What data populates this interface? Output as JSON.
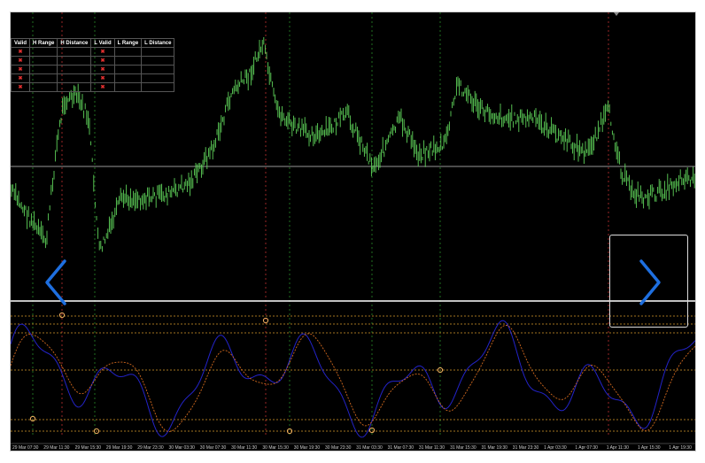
{
  "table": {
    "headers": [
      "Valid",
      "H Range",
      "H Distance",
      "L Valid",
      "L Range",
      "L Distance"
    ],
    "rows": [
      [
        "✖",
        "",
        "",
        "✖",
        "",
        ""
      ],
      [
        "✖",
        "",
        "",
        "✖",
        "",
        ""
      ],
      [
        "✖",
        "",
        "",
        "✖",
        "",
        ""
      ],
      [
        "✖",
        "",
        "",
        "✖",
        "",
        ""
      ],
      [
        "✖",
        "",
        "",
        "✖",
        "",
        ""
      ]
    ]
  },
  "time_axis": [
    "29 Mar 07:30",
    "29 Mar 11:30",
    "29 Mar 15:30",
    "29 Mar 19:30",
    "29 Mar 23:30",
    "30 Mar 03:30",
    "30 Mar 07:30",
    "30 Mar 11:30",
    "30 Mar 15:30",
    "30 Mar 19:30",
    "30 Mar 23:30",
    "31 Mar 03:30",
    "31 Mar 07:30",
    "31 Mar 11:30",
    "31 Mar 15:30",
    "31 Mar 19:30",
    "31 Mar 23:30",
    "1 Apr 03:30",
    "1 Apr 07:30",
    "1 Apr 11:30",
    "1 Apr 15:30",
    "1 Apr 19:30"
  ],
  "nav": {
    "prev_icon": "chevron-left-icon",
    "next_icon": "chevron-right-icon"
  },
  "colors": {
    "candles": "#5fd35a",
    "oscillator_main": "#2323c8",
    "oscillator_signal": "#d2691e",
    "level_lines": "#d89b2a",
    "nav_arrow": "#1e6fe0"
  }
}
